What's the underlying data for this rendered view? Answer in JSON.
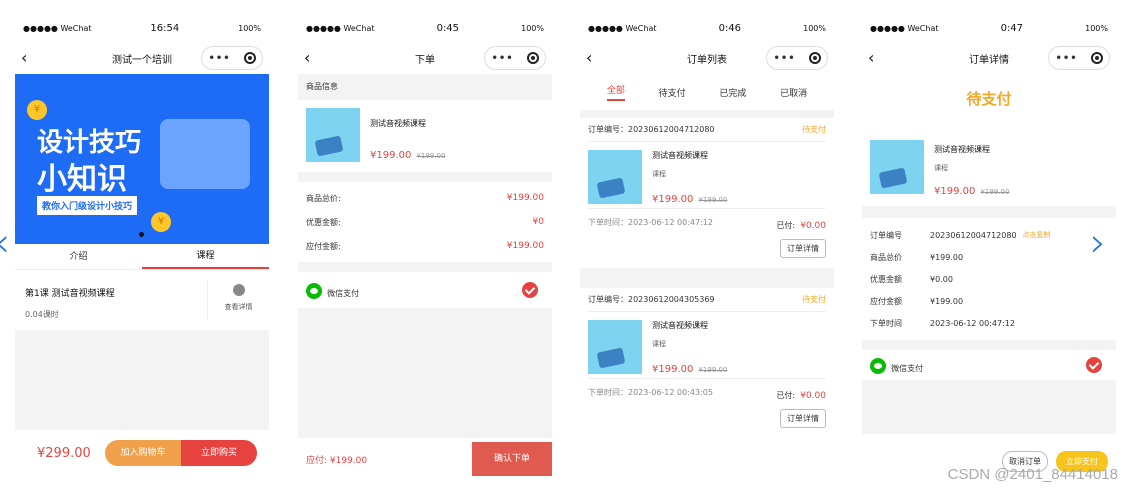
{
  "status_bar": {
    "carrier": "●●●●● WeChat",
    "battery": "100%"
  },
  "screen1": {
    "time": "16:54",
    "title": "测试一个培训",
    "banner": {
      "line1": "设计技巧",
      "line2": "小知识",
      "sub": "教你入门级设计小技巧"
    },
    "tabs": [
      "介绍",
      "课程"
    ],
    "lesson": {
      "title": "第1课 测试音视频课程",
      "hours": "0.04课时",
      "detail": "查看详情"
    },
    "price": "¥299.00",
    "add_cart": "加入购物车",
    "buy_now": "立即购买"
  },
  "screen2": {
    "time": "0:45",
    "title": "下单",
    "section": "商品信息",
    "product": {
      "name": "测试音视频课程",
      "price": "¥199.00",
      "orig": "¥199.00"
    },
    "summary": [
      {
        "label": "商品总价:",
        "value": "¥199.00"
      },
      {
        "label": "优惠金额:",
        "value": "¥0"
      },
      {
        "label": "应付金额:",
        "value": "¥199.00"
      }
    ],
    "pay": "微信支付",
    "due": "应付: ¥199.00",
    "confirm": "确认下单"
  },
  "screen3": {
    "time": "0:46",
    "title": "订单列表",
    "tabs": [
      "全部",
      "待支付",
      "已完成",
      "已取消"
    ],
    "orders": [
      {
        "no": "订单编号：20230612004712080",
        "status": "待支付",
        "name": "测试音视频课程",
        "tag": "课程",
        "price": "¥199.00",
        "orig": "¥199.00",
        "time": "下单时间：2023-06-12 00:47:12",
        "paid_label": "已付:",
        "paid": "¥0.00",
        "detail": "订单详情"
      },
      {
        "no": "订单编号：20230612004305369",
        "status": "待支付",
        "name": "测试音视频课程",
        "tag": "课程",
        "price": "¥199.00",
        "orig": "¥199.00",
        "time": "下单时间：2023-06-12 00:43:05",
        "paid_label": "已付:",
        "paid": "¥0.00",
        "detail": "订单详情"
      }
    ]
  },
  "screen4": {
    "time": "0:47",
    "title": "订单详情",
    "status": "待支付",
    "product": {
      "name": "测试音视频课程",
      "tag": "课程",
      "price": "¥199.00",
      "orig": "¥199.00"
    },
    "info": [
      {
        "label": "订单编号",
        "value": "20230612004712080",
        "extra": "点击复制"
      },
      {
        "label": "商品总价",
        "value": "¥199.00"
      },
      {
        "label": "优惠金额",
        "value": "¥0.00"
      },
      {
        "label": "应付金额",
        "value": "¥199.00"
      },
      {
        "label": "下单时间",
        "value": "2023-06-12 00:47:12"
      }
    ],
    "pay": "微信支付",
    "cancel": "取消订单",
    "pay_now": "立即支付"
  },
  "watermark": "CSDN @2401_84414018",
  "colors": {
    "red": "#e64340",
    "orange": "#f5a623",
    "blue": "#1a73e8",
    "banner": "#1e6bf5"
  }
}
